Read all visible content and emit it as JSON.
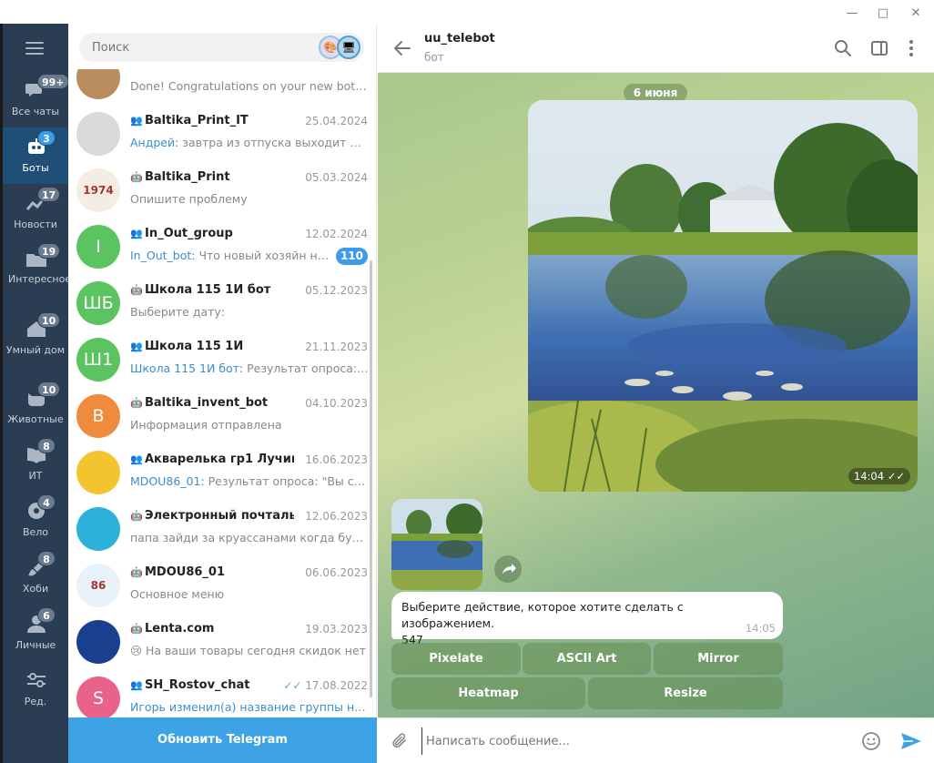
{
  "window": {
    "controls": [
      "minimize",
      "maximize",
      "close"
    ]
  },
  "search": {
    "placeholder": "Поиск"
  },
  "folders": [
    {
      "label": "Все чаты",
      "badge": "99+",
      "icon": "chat-bubbles-icon"
    },
    {
      "label": "Боты",
      "badge": "3",
      "icon": "bot-icon",
      "active": true
    },
    {
      "label": "Новости",
      "badge": "17",
      "icon": "chart-icon"
    },
    {
      "label": "Интересное",
      "badge": "19",
      "icon": "folder-icon"
    },
    {
      "label": "Умный дом",
      "badge": "10",
      "icon": "house-icon"
    },
    {
      "label": "Животные",
      "badge": "10",
      "icon": "cat-icon"
    },
    {
      "label": "ИТ",
      "badge": "8",
      "icon": "book-icon"
    },
    {
      "label": "Вело",
      "badge": "4",
      "icon": "ball-icon"
    },
    {
      "label": "Хоби",
      "badge": "8",
      "icon": "brush-icon"
    },
    {
      "label": "Личные",
      "badge": "6",
      "icon": "person-icon"
    },
    {
      "label": "Ред.",
      "badge": "",
      "icon": "sliders-icon"
    }
  ],
  "chats": [
    {
      "name": "",
      "date": "",
      "sender": "",
      "preview": "Done! Congratulations on your new bot. Y...",
      "avatar": "",
      "avatar_color": "#b98d5e",
      "type": "none"
    },
    {
      "name": "Baltika_Print_IT",
      "date": "25.04.2024",
      "sender": "Андрей:",
      "preview": " завтра из отпуска выходит Погр...",
      "avatar": "",
      "avatar_color": "#d9d9d9",
      "type": "group"
    },
    {
      "name": "Baltika_Print",
      "date": "05.03.2024",
      "sender": "",
      "preview": "Опишите проблему",
      "avatar": "1974",
      "avatar_color": "#f3ede2",
      "type": "bot"
    },
    {
      "name": "In_Out_group",
      "date": "12.02.2024",
      "sender": "In_Out_bot:",
      "preview": " Что новый хозяйн над...",
      "avatar": "I",
      "avatar_color": "#5bc35f",
      "type": "group",
      "unread": "110"
    },
    {
      "name": "Школа 115 1И бот",
      "date": "05.12.2023",
      "sender": "",
      "preview": "Выберите дату:",
      "avatar": "ШБ",
      "avatar_color": "#5bc35f",
      "type": "bot"
    },
    {
      "name": "Школа 115 1И",
      "date": "21.11.2023",
      "sender": "Школа 115 1И бот:",
      "preview": " Результат опроса: \"В...",
      "avatar": "Ш1",
      "avatar_color": "#5bc35f",
      "type": "group"
    },
    {
      "name": "Baltika_invent_bot",
      "date": "04.10.2023",
      "sender": "",
      "preview": "Информация отправлена",
      "avatar": "B",
      "avatar_color": "#f08a3c",
      "type": "bot"
    },
    {
      "name": "Акварелька гр1 Лучики",
      "date": "16.06.2023",
      "sender": "MDOU86_01:",
      "preview": " Результат опроса: \"Вы сего...",
      "avatar": "",
      "avatar_color": "#f4c430",
      "type": "group"
    },
    {
      "name": "Электронный почтальо...",
      "date": "12.06.2023",
      "sender": "",
      "preview": "папа зайди за круассанами когда будеш...",
      "avatar": "",
      "avatar_color": "#2db1d8",
      "type": "bot"
    },
    {
      "name": "MDOU86_01",
      "date": "06.06.2023",
      "sender": "",
      "preview": "Основное меню",
      "avatar": "86",
      "avatar_color": "#e8f2f8",
      "type": "bot"
    },
    {
      "name": "Lenta.com",
      "date": "19.03.2023",
      "sender": "",
      "preview": "😢 На ваши товары сегодня скидок нет",
      "avatar": "",
      "avatar_color": "#1b3f8f",
      "type": "bot"
    },
    {
      "name": "SH_Rostov_chat",
      "date": "17.08.2022",
      "sender": "Игорь изменил(а) название группы на «...",
      "preview": "",
      "avatar": "S",
      "avatar_color": "#e8628a",
      "type": "group",
      "read_ticks": "✓✓"
    }
  ],
  "update_button": "Обновить Telegram",
  "chat": {
    "title": "uu_telebot",
    "subtitle": "бот",
    "date_divider": "6 июня",
    "photo_time": "14:04",
    "photo_ticks": "✓✓",
    "message_text": "Выберите действие, которое хотите сделать с изображением.",
    "message_number": "547",
    "message_time": "14:05",
    "keyboard_row1": [
      "Pixelate",
      "ASCII Art",
      "Mirror"
    ],
    "keyboard_row2": [
      "Heatmap",
      "Resize"
    ]
  },
  "composer": {
    "placeholder": "Написать сообщение..."
  },
  "colors": {
    "accent": "#3ea2e6",
    "folders_bg": "#2a3d52",
    "folder_active": "#1f4f77"
  }
}
